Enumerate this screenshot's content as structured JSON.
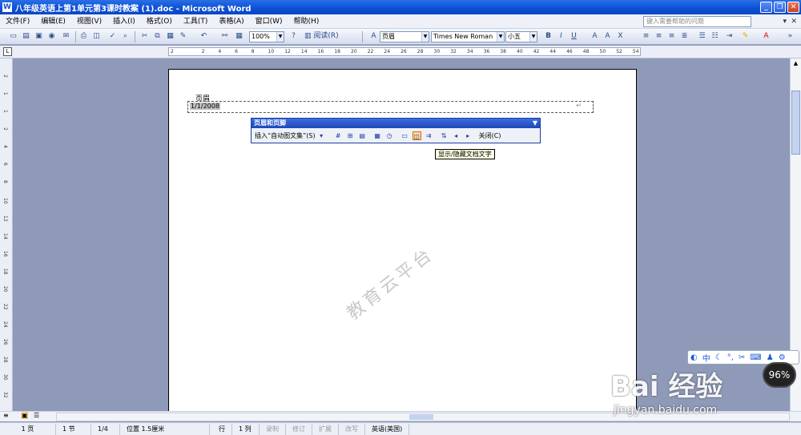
{
  "window": {
    "title": "八年级英语上第1单元第3课时教案 (1).doc - Microsoft Word",
    "icon": "word-doc-icon"
  },
  "menubar": {
    "items": [
      "文件(F)",
      "编辑(E)",
      "视图(V)",
      "插入(I)",
      "格式(O)",
      "工具(T)",
      "表格(A)",
      "窗口(W)",
      "帮助(H)"
    ],
    "help_placeholder": "键入需要帮助的问题"
  },
  "toolbar": {
    "zoom": "100%",
    "read_label": "阅读(R)",
    "style": "页眉",
    "font": "Times New Roman",
    "size": "小五"
  },
  "ruler": {
    "ticks": [
      "2",
      "2",
      "4",
      "6",
      "8",
      "10",
      "12",
      "14",
      "16",
      "18",
      "20",
      "22",
      "24",
      "26",
      "28",
      "30",
      "32",
      "34",
      "36",
      "38",
      "40",
      "42",
      "44",
      "46",
      "48",
      "50",
      "52",
      "54"
    ],
    "vticks": [
      "2",
      "1",
      "1",
      "2",
      "4",
      "6",
      "8",
      "10",
      "12",
      "14",
      "16",
      "18",
      "20",
      "22",
      "24",
      "26",
      "28",
      "30",
      "32"
    ]
  },
  "document": {
    "header_label": "页眉",
    "header_date": "1/1/2008",
    "para_mark": "↵"
  },
  "hf_toolbar": {
    "title": "页眉和页脚",
    "insert_autotext": "插入“自动图文集”(S)",
    "close": "关闭(C)",
    "tooltip": "显示/隐藏文档文字"
  },
  "statusbar": {
    "page": "1 页",
    "section": "1 节",
    "pages": "1/4",
    "position": "位置 1.5厘米",
    "line": "行",
    "col": "1 列",
    "rec": "录制",
    "trk": "修订",
    "ext": "扩展",
    "ovr": "改写",
    "lang": "英语(美国)"
  },
  "overlay": {
    "ime_lang": "中",
    "percent": "96%",
    "watermark_logo": "Bai 经验",
    "watermark_url": "jingyan.baidu.com",
    "page_watermark": "教育云平台"
  }
}
